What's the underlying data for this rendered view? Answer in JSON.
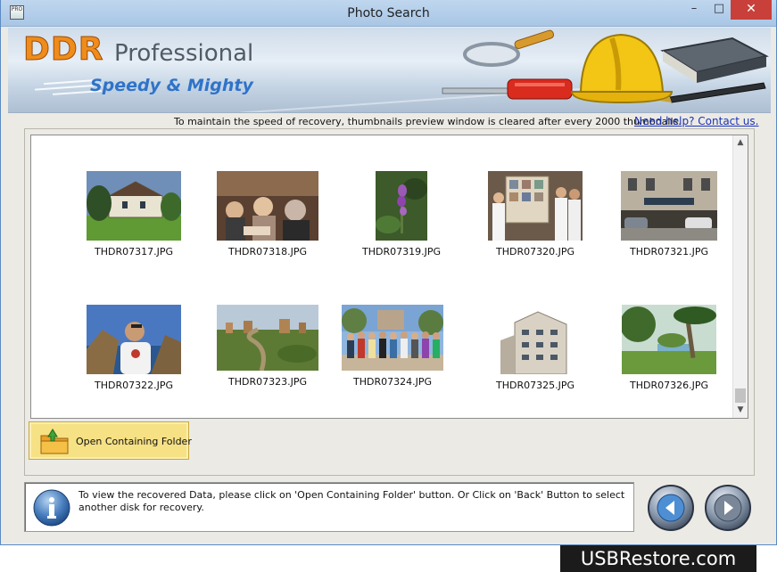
{
  "window": {
    "title": "Photo Search",
    "app_icon_text": "PRO",
    "minimize_glyph": "–",
    "maximize_glyph": "□",
    "close_glyph": "✕"
  },
  "banner": {
    "brand": "DDR",
    "product": "Professional",
    "tagline": "Speedy & Mighty"
  },
  "info": {
    "speed_note": "To maintain the speed of recovery, thumbnails preview window is cleared after every 2000 thumbnails.",
    "help_link": "Need help? Contact us."
  },
  "thumbnails": [
    {
      "name": "THDR07317.JPG"
    },
    {
      "name": "THDR07318.JPG"
    },
    {
      "name": "THDR07319.JPG"
    },
    {
      "name": "THDR07320.JPG"
    },
    {
      "name": "THDR07321.JPG"
    },
    {
      "name": "THDR07322.JPG"
    },
    {
      "name": "THDR07323.JPG"
    },
    {
      "name": "THDR07324.JPG"
    },
    {
      "name": "THDR07325.JPG"
    },
    {
      "name": "THDR07326.JPG"
    }
  ],
  "scrollbar": {
    "up_glyph": "▲",
    "down_glyph": "▼"
  },
  "actions": {
    "open_folder_label": "Open Containing Folder",
    "folder_icon": "folder-up-icon"
  },
  "status": {
    "text": "To view the recovered Data, please click on 'Open Containing Folder' button. Or Click on 'Back' Button to select another disk for recovery.",
    "info_icon": "info-icon"
  },
  "navigation": {
    "back_icon": "arrow-left-icon",
    "next_icon": "arrow-right-icon"
  },
  "watermark": "USBRestore.com",
  "colors": {
    "accent_orange": "#f08c1c",
    "tagline_blue": "#2f73c9",
    "link_blue": "#1a33b8",
    "button_yellow": "#f6e185",
    "close_red": "#c9403a"
  }
}
